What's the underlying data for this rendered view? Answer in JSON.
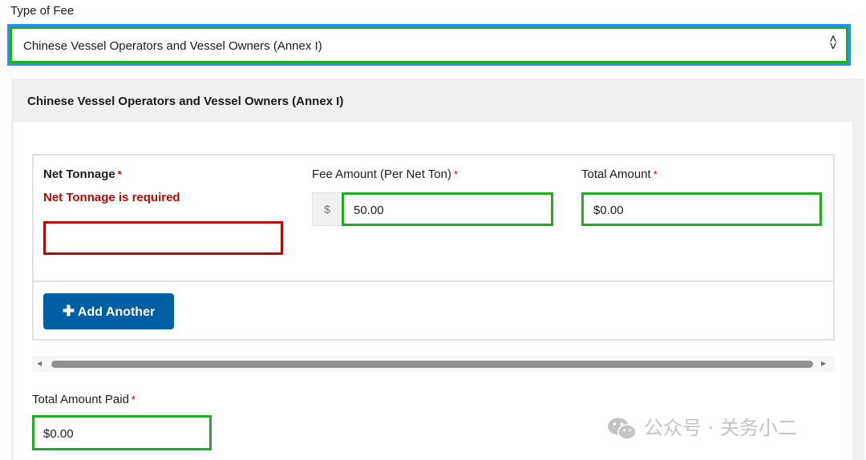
{
  "type_of_fee": {
    "label": "Type of Fee",
    "selected": "Chinese Vessel Operators and Vessel Owners (Annex I)",
    "arrow_up": "˄",
    "arrow_down": "˅"
  },
  "panel": {
    "title": "Chinese Vessel Operators and Vessel Owners (Annex I)"
  },
  "row": {
    "net_tonnage_label": "Net Tonnage",
    "net_tonnage_error": "Net Tonnage is required",
    "net_tonnage_value": "",
    "fee_amount_label": "Fee Amount (Per Net Ton)",
    "currency_symbol": "$",
    "fee_amount_value": "50.00",
    "total_amount_label": "Total Amount",
    "total_amount_value": "$0.00",
    "required_marker": "*"
  },
  "add_button": {
    "icon": "plus-icon",
    "label": "Add Another"
  },
  "total_paid": {
    "label": "Total Amount Paid",
    "value": "$0.00"
  },
  "watermark": {
    "text": "公众号 · 关务小二",
    "icon": "wechat-icon"
  },
  "colors": {
    "focus_blue": "#2491ff",
    "highlight_green": "#1fae1f",
    "error_red": "#b50909",
    "button_blue": "#005ea2"
  }
}
